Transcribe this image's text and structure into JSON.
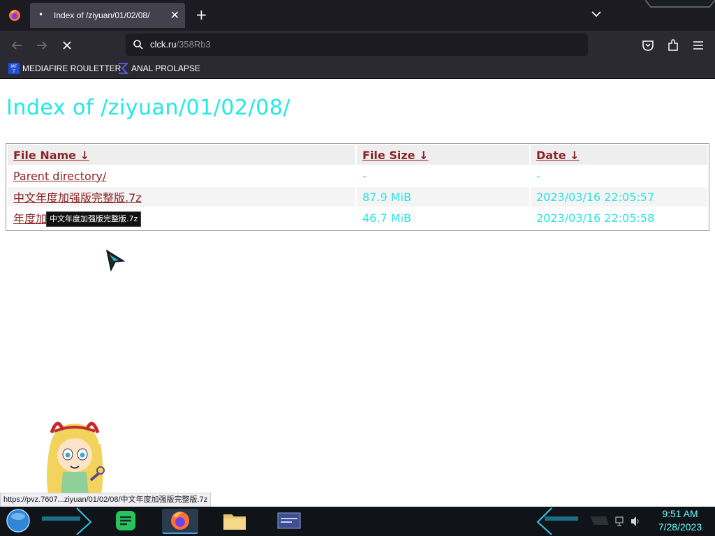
{
  "browser": {
    "tab_title": "Index of /ziyuan/01/02/08/",
    "url_host": "clck.ru",
    "url_path": "/358Rb3",
    "bookmarks": [
      {
        "label": "MEDIAFIRE ROULETTER"
      },
      {
        "label": "ANAL PROLAPSE"
      }
    ]
  },
  "page": {
    "heading": "Index of /ziyuan/01/02/08/",
    "columns": [
      "File Name",
      "File Size",
      "Date"
    ],
    "sort_arrow": "↓",
    "rows": [
      {
        "name": "Parent directory/",
        "size": "-",
        "date": "-"
      },
      {
        "name": "中文年度加强版完整版.7z",
        "size": "87.9 MiB",
        "date": "2023/03/16 22:05:57"
      },
      {
        "name": "年度加强版完整版.7z",
        "size": "46.7 MiB",
        "date": "2023/03/16 22:05:58"
      }
    ],
    "tooltip": "中文年度加强版完整版.7z"
  },
  "status_url": "https://pvz.7607...ziyuan/01/02/08/中文年度加强版完整版.7z",
  "taskbar": {
    "time": "9:51 AM",
    "date": "7/28/2023"
  },
  "colors": {
    "heading": "#22e8e8",
    "link": "#8c2323",
    "value_cyan": "#2de2e2",
    "clock": "#66ffff"
  }
}
